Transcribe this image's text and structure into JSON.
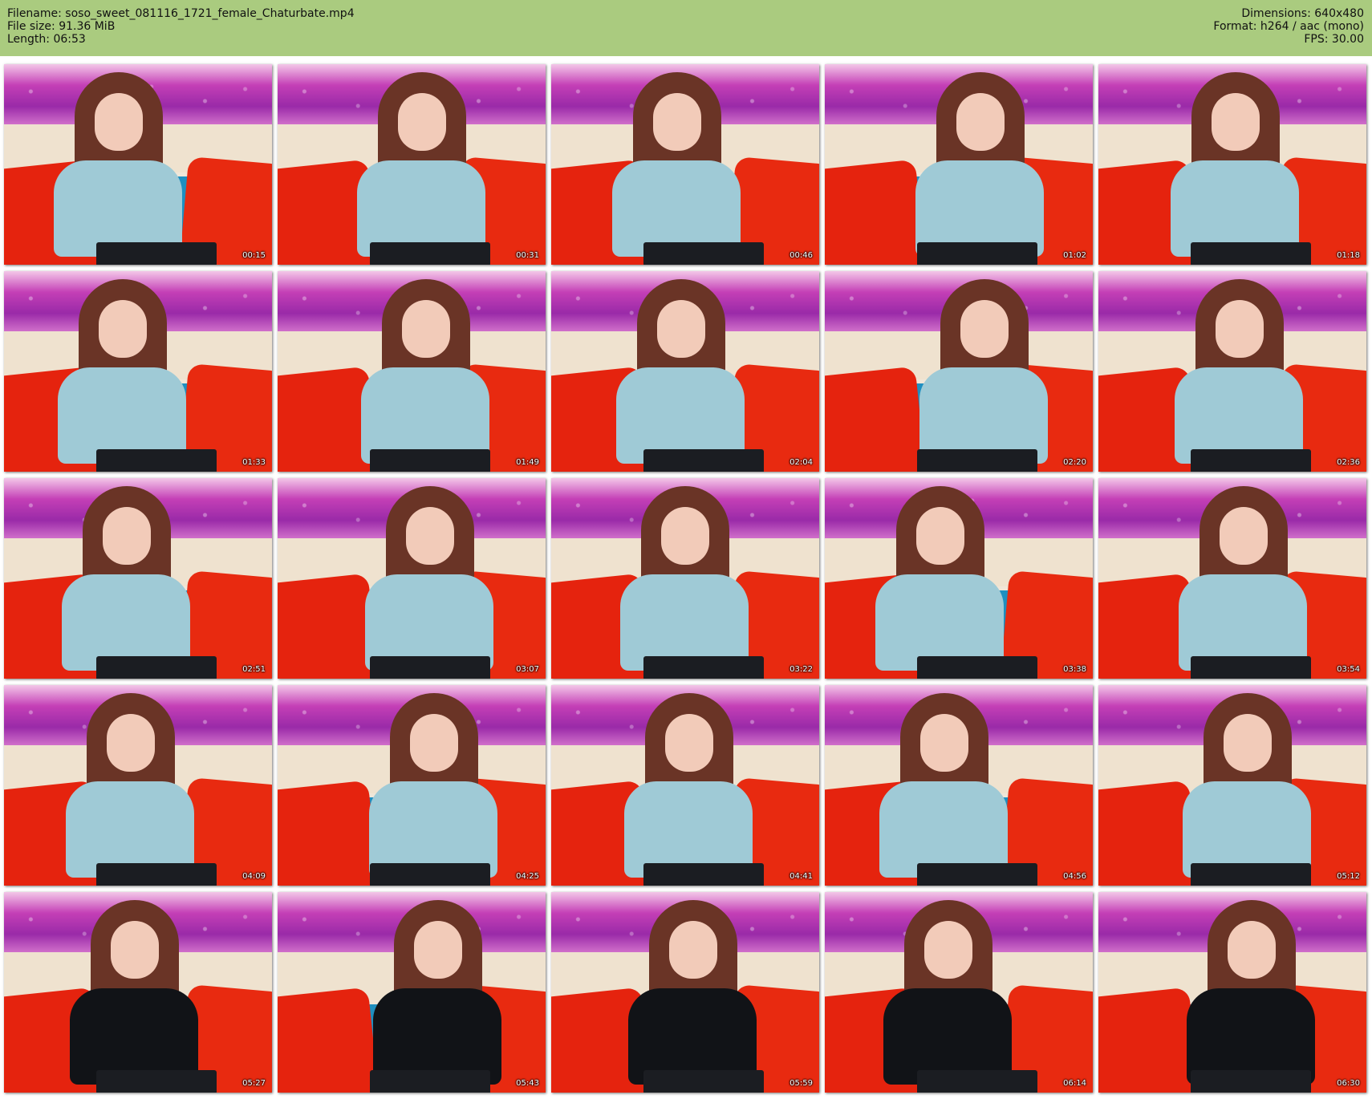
{
  "header": {
    "filename": "Filename: soso_sweet_081116_1721_female_Chaturbate.mp4",
    "filesize": "File size: 91.36 MiB",
    "length": "Length: 06:53",
    "dimensions": "Dimensions: 640x480",
    "format": "Format: h264 / aac (mono)",
    "fps": "FPS: 30.00"
  },
  "colors": {
    "header_bg": "#aacb7f",
    "page_bg": "#ffffff"
  },
  "thumbnails": [
    {
      "time": "00:15",
      "top": "light"
    },
    {
      "time": "00:31",
      "top": "light"
    },
    {
      "time": "00:46",
      "top": "light"
    },
    {
      "time": "01:02",
      "top": "light"
    },
    {
      "time": "01:18",
      "top": "light"
    },
    {
      "time": "01:33",
      "top": "light"
    },
    {
      "time": "01:49",
      "top": "light"
    },
    {
      "time": "02:04",
      "top": "light"
    },
    {
      "time": "02:20",
      "top": "light"
    },
    {
      "time": "02:36",
      "top": "light"
    },
    {
      "time": "02:51",
      "top": "light"
    },
    {
      "time": "03:07",
      "top": "light"
    },
    {
      "time": "03:22",
      "top": "light"
    },
    {
      "time": "03:38",
      "top": "light"
    },
    {
      "time": "03:54",
      "top": "light"
    },
    {
      "time": "04:09",
      "top": "light"
    },
    {
      "time": "04:25",
      "top": "light"
    },
    {
      "time": "04:41",
      "top": "light"
    },
    {
      "time": "04:56",
      "top": "light"
    },
    {
      "time": "05:12",
      "top": "light"
    },
    {
      "time": "05:27",
      "top": "dark"
    },
    {
      "time": "05:43",
      "top": "dark"
    },
    {
      "time": "05:59",
      "top": "dark"
    },
    {
      "time": "06:14",
      "top": "dark"
    },
    {
      "time": "06:30",
      "top": "dark"
    }
  ]
}
